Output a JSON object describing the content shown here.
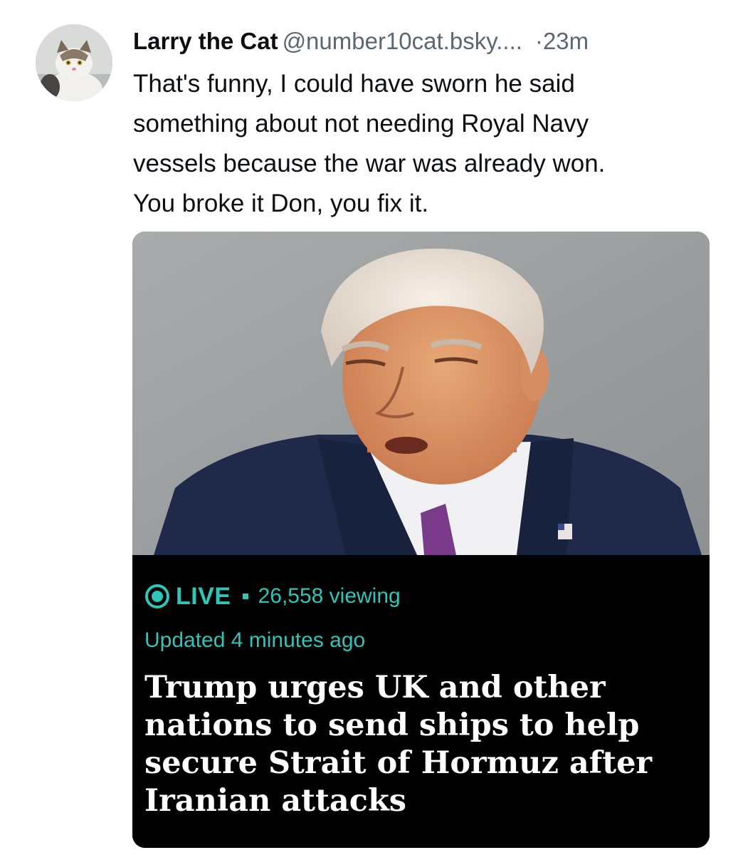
{
  "post": {
    "author_name": "Larry the Cat",
    "handle": "@number10cat.bsky....",
    "separator": "·",
    "time": "23m",
    "text_lines": [
      "That's funny, I could have sworn he said",
      "something about not needing Royal Navy",
      "vessels because the war was already won.",
      "You broke it Don, you fix it."
    ]
  },
  "embed": {
    "live_label": "LIVE",
    "live_separator": "·",
    "viewing": "26,558 viewing",
    "updated": "Updated 4 minutes ago",
    "headline_lines": [
      "Trump urges UK and other",
      "nations to send ships to help",
      "secure Strait of Hormuz after",
      "Iranian attacks"
    ],
    "live_icon": "live-radio-icon"
  },
  "colors": {
    "live_accent": "#2fc5b9",
    "text_primary": "#0b0f14",
    "text_secondary": "#5b6773",
    "caption_bg": "#000000"
  }
}
